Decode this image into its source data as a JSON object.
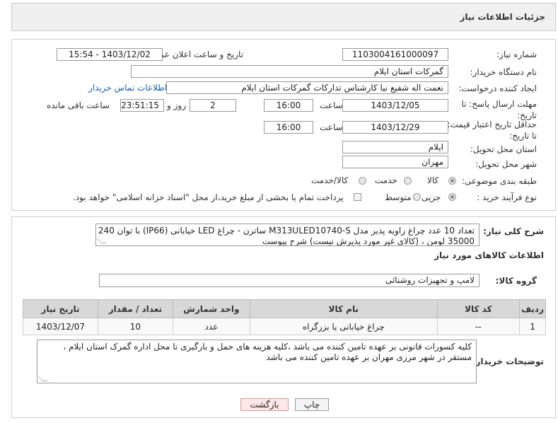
{
  "header": {
    "title": "جزئیات اطلاعات نیاز"
  },
  "form": {
    "need_number_label": "شماره نیاز:",
    "need_number": "1103004161000097",
    "announce_label": "تاریخ و ساعت اعلان عمومی:",
    "announce_value": "1403/12/02 - 15:54",
    "buyer_org_label": "نام دستگاه خریدار:",
    "buyer_org": "گمرکات استان ایلام",
    "creator_label": "ایجاد کننده درخواست:",
    "creator": "نعمت اله شفیع نیا کارشناس تدارکات گمرکات استان ایلام",
    "contact_link": "اطلاعات تماس خریدار",
    "deadline_label": "مهلت ارسال پاسخ: تا تاریخ:",
    "deadline_date": "1403/12/05",
    "time_label": "ساعت",
    "deadline_time": "16:00",
    "days_value": "2",
    "days_label": "روز و",
    "remaining_time": "23:51:15",
    "remaining_label": "ساعت باقی مانده",
    "validity_label": "حداقل تاریخ اعتبار قیمت: تا تاریخ:",
    "validity_date": "1403/12/29",
    "validity_time": "16:00",
    "province_label": "استان محل تحویل:",
    "province": "ایلام",
    "city_label": "شهر محل تحویل:",
    "city": "مهران",
    "category_label": "طبقه بندی موضوعی:",
    "category_options": [
      "کالا",
      "خدمت",
      "کالا/خدمت"
    ],
    "process_label": "نوع فرآیند خرید :",
    "process_options": [
      "جزیی",
      "متوسط"
    ],
    "payment_note": "پرداخت تمام یا بخشی از مبلغ خرید،از محل \"اسناد خزانه اسلامی\" خواهد بود."
  },
  "details": {
    "summary_label": "شرح کلی نیاز:",
    "summary_line1": "تعداد 10 عدد چراغ زاویه پذیر  مدل  M313ULED10740-S ساترن - چراغ LED خیابانی (IP66) با توان 240 وات",
    "summary_line2": "35000 لومن ،  (کالای غیر مورد پذیرش نیست) شرح پیوست",
    "goods_info_title": "اطلاعات کالاهای مورد نیاز",
    "goods_group_label": "گروه کالا:",
    "goods_group": "لامپ و تجهیزات روشنائی",
    "table": {
      "headers": [
        "ردیف",
        "کد کالا",
        "نام کالا",
        "واحد شمارش",
        "تعداد / مقدار",
        "تاریخ نیاز"
      ],
      "rows": [
        [
          "1",
          "--",
          "چراغ خیابانی یا بزرگراه",
          "عدد",
          "10",
          "1403/12/07"
        ]
      ]
    },
    "buyer_notes_label": "توضیحات خریدار:",
    "buyer_notes": "کلیه کسورات قانونی بر عهده تامین کننده می باشد ،کلیه هزینه های حمل و بارگیری تا محل اداره گمرک استان ایلام ، مستقر در شهر مرزی مهران بر عهده تامین کننده می باشد"
  },
  "buttons": {
    "print": "چاپ",
    "back": "بازگشت"
  }
}
